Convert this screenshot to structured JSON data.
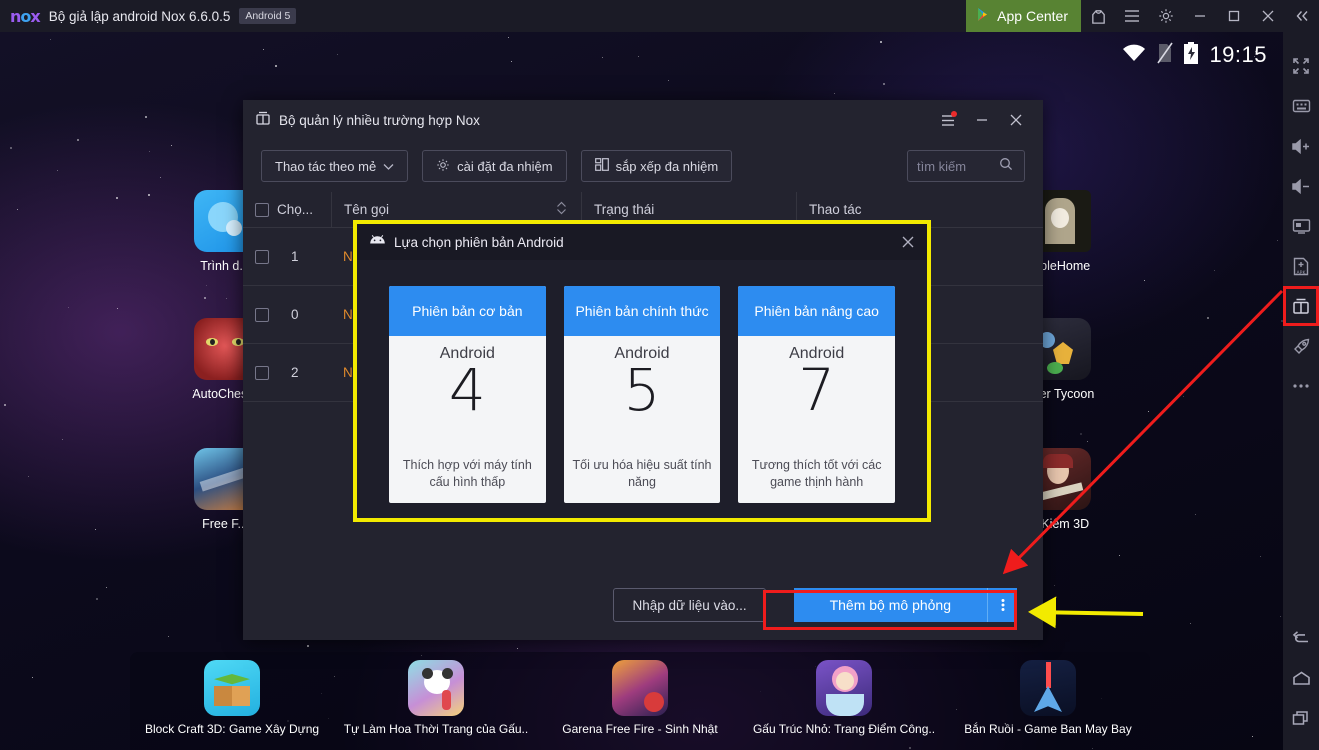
{
  "titlebar": {
    "logo": "nox",
    "title": "Bộ giả lập android Nox 6.6.0.5",
    "badge": "Android 5",
    "app_center": "App Center",
    "icons": [
      "shirt-icon",
      "menu-icon",
      "gear-icon",
      "minimize-icon",
      "maximize-icon",
      "close-icon",
      "collapse-icon"
    ]
  },
  "statusbar": {
    "time": "19:15",
    "icons": [
      "wifi-icon",
      "no-sim-icon",
      "battery-charging-icon"
    ]
  },
  "sidebar": {
    "items": [
      {
        "name": "fullscreen-icon",
        "label": "Toàn màn hình"
      },
      {
        "name": "keyboard-icon",
        "label": "Bàn phím"
      },
      {
        "name": "volume-up-icon",
        "label": "Tăng âm lượng"
      },
      {
        "name": "volume-down-icon",
        "label": "Giảm âm lượng"
      },
      {
        "name": "screenshot-icon",
        "label": "Chụp màn hình"
      },
      {
        "name": "install-apk-icon",
        "label": "Cài đặt APK"
      },
      {
        "name": "multi-instance-icon",
        "label": "Đa nhiệm",
        "selected": true
      },
      {
        "name": "boost-icon",
        "label": "Tăng tốc"
      },
      {
        "name": "more-icon",
        "label": "Thêm"
      }
    ],
    "nav": [
      {
        "name": "back-icon",
        "label": "Quay lại"
      },
      {
        "name": "home-icon",
        "label": "Trang chủ"
      },
      {
        "name": "recents-icon",
        "label": "Ứng dụng gần đây"
      }
    ]
  },
  "desktop_icons": [
    {
      "label": "Trình d...",
      "kind": "browser"
    },
    {
      "label": "AutoChes...",
      "kind": "autochess"
    },
    {
      "label": "Free F...",
      "kind": "freefire"
    },
    {
      "label": "...bleHome",
      "kind": "simplehome"
    },
    {
      "label": "...ter Tycoon",
      "kind": "tycoon"
    },
    {
      "label": "...Kiếm 3D",
      "kind": "kiem3d"
    }
  ],
  "dock": [
    {
      "label": "Block Craft 3D: Game Xây Dựng",
      "kind": "blockcraft"
    },
    {
      "label": "Tự Làm Hoa Thời Trang của Gấu..",
      "kind": "panda"
    },
    {
      "label": "Garena Free Fire - Sinh Nhật",
      "kind": "garena"
    },
    {
      "label": "Gấu Trúc Nhỏ: Trang Điểm Công..",
      "kind": "princess"
    },
    {
      "label": "Bắn Ruồi - Game Ban May Bay",
      "kind": "shooter"
    }
  ],
  "multi_manager": {
    "title": "Bộ quản lý nhiều trường hợp Nox",
    "window_icon": "multi-instance-icon",
    "header_buttons": [
      "menu-icon",
      "minimize-icon",
      "close-icon"
    ],
    "toolbar": {
      "batch_action": "Thao tác theo mẻ",
      "settings": "cài đặt đa nhiệm",
      "arrange": "sắp xếp đa nhiệm",
      "search_placeholder": "tìm kiếm",
      "search_value": ""
    },
    "table": {
      "headers": [
        "Chọ...",
        "Tên gọi",
        "Trạng thái",
        "Thao tác"
      ],
      "rows": [
        {
          "index": "1",
          "name": "No...",
          "state": "",
          "actions": [
            "restore-icon",
            "clone-icon",
            "delete-icon"
          ]
        },
        {
          "index": "0",
          "name": "No...",
          "state": "",
          "actions": [
            "restore-icon",
            "clone-icon",
            "delete-icon"
          ]
        },
        {
          "index": "2",
          "name": "No...",
          "state": "",
          "actions": [
            "restore-icon",
            "clone-icon",
            "delete-icon"
          ]
        }
      ]
    },
    "footer": {
      "import": "Nhập dữ liệu vào...",
      "add": "Thêm bộ mô phỏng",
      "add_more_icon": "kebab-menu-icon"
    }
  },
  "version_modal": {
    "title": "Lựa chọn phiên bản Android",
    "icon": "android-icon",
    "close_icon": "close-icon",
    "cards": [
      {
        "heading": "Phiên bản cơ bản",
        "android_label": "Android",
        "version": "4",
        "description": "Thích hợp với máy tính cấu hình thấp"
      },
      {
        "heading": "Phiên bản chính thức",
        "android_label": "Android",
        "version": "5",
        "description": "Tối ưu hóa hiệu suất tính năng"
      },
      {
        "heading": "Phiên bản nâng cao",
        "android_label": "Android",
        "version": "7",
        "description": "Tương thích tốt với các game thịnh hành"
      }
    ]
  },
  "annotations": {
    "highlight_color_yellow": "#f2ea00",
    "highlight_color_red": "#ef1c1c",
    "arrow_red": "from multi-instance sidebar icon to add-emulator button",
    "arrow_yellow": "points to add-emulator dropdown"
  },
  "colors": {
    "accent_blue": "#2d8cf0",
    "app_center_green": "#588333",
    "window_bg": "#23232f",
    "titlebar_bg": "#1b1b26"
  }
}
